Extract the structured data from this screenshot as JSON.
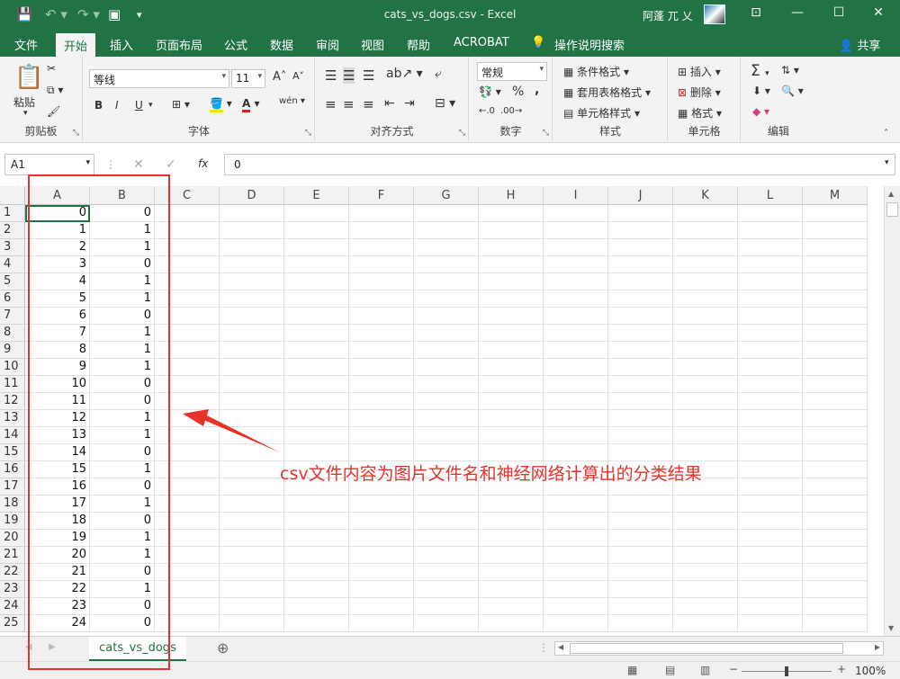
{
  "titlebar": {
    "title": "cats_vs_dogs.csv  -  Excel",
    "user": "阿蓬 兀 乂"
  },
  "tabs": [
    "文件",
    "开始",
    "插入",
    "页面布局",
    "公式",
    "数据",
    "审阅",
    "视图",
    "帮助",
    "ACROBAT",
    "操作说明搜索"
  ],
  "share_label": "共享",
  "ribbon": {
    "clipboard": {
      "paste": "粘贴",
      "label": "剪贴板"
    },
    "font": {
      "name": "等线",
      "size": "11",
      "label": "字体",
      "bold": "B",
      "italic": "I",
      "underline": "U"
    },
    "alignment": {
      "label": "对齐方式"
    },
    "number": {
      "format": "常规",
      "label": "数字",
      "percent": "%",
      "comma": ","
    },
    "styles": {
      "conditional": "条件格式",
      "table": "套用表格格式",
      "cell": "单元格样式",
      "label": "样式"
    },
    "cells": {
      "insert": "插入",
      "delete": "删除",
      "format": "格式",
      "label": "单元格"
    },
    "editing": {
      "label": "编辑"
    }
  },
  "formula_bar": {
    "cell_ref": "A1",
    "value": "0",
    "fx": "fx"
  },
  "columns": [
    "A",
    "B",
    "C",
    "D",
    "E",
    "F",
    "G",
    "H",
    "I",
    "J",
    "K",
    "L",
    "M"
  ],
  "rows": [
    [
      "0",
      "0"
    ],
    [
      "1",
      "1"
    ],
    [
      "2",
      "1"
    ],
    [
      "3",
      "0"
    ],
    [
      "4",
      "1"
    ],
    [
      "5",
      "1"
    ],
    [
      "6",
      "0"
    ],
    [
      "7",
      "1"
    ],
    [
      "8",
      "1"
    ],
    [
      "9",
      "1"
    ],
    [
      "10",
      "0"
    ],
    [
      "11",
      "0"
    ],
    [
      "12",
      "1"
    ],
    [
      "13",
      "1"
    ],
    [
      "14",
      "0"
    ],
    [
      "15",
      "1"
    ],
    [
      "16",
      "0"
    ],
    [
      "17",
      "1"
    ],
    [
      "18",
      "0"
    ],
    [
      "19",
      "1"
    ],
    [
      "20",
      "1"
    ],
    [
      "21",
      "0"
    ],
    [
      "22",
      "1"
    ],
    [
      "23",
      "0"
    ],
    [
      "24",
      "0"
    ]
  ],
  "row_numbers": [
    "1",
    "2",
    "3",
    "4",
    "5",
    "6",
    "7",
    "8",
    "9",
    "10",
    "11",
    "12",
    "13",
    "14",
    "15",
    "16",
    "17",
    "18",
    "19",
    "20",
    "21",
    "22",
    "23",
    "24",
    "25"
  ],
  "sheet_tab": "cats_vs_dogs",
  "zoom": "100%",
  "annotation": "csv文件内容为图片文件名和神经网络计算出的分类结果",
  "colors": {
    "excel_green": "#217346",
    "annotation_red": "#e8312a"
  }
}
